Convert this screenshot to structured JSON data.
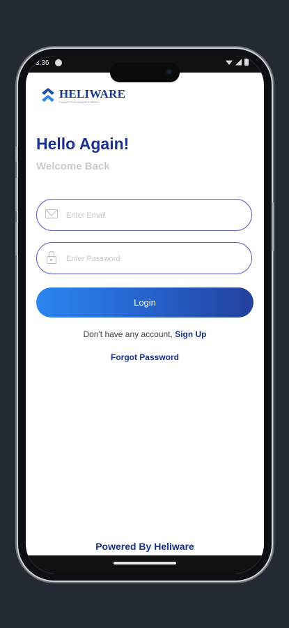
{
  "status_bar": {
    "time": "3:36"
  },
  "brand": {
    "name": "HELIWARE",
    "tagline": "A company for Developing Drone Solutions"
  },
  "login": {
    "title": "Hello Again!",
    "subtitle": "Welcome Back",
    "email_placeholder": "Enter Email",
    "password_placeholder": "Enter Password",
    "login_label": "Login",
    "no_account_text": "Don't have any account,",
    "signup_label": "Sign Up",
    "forgot_label": "Forgot Password"
  },
  "footer": {
    "powered_by": "Powered By Heliware"
  },
  "colors": {
    "primary": "#1b3190",
    "button_start": "#2b86f0",
    "button_end": "#24419e",
    "input_border": "#5a5fc9",
    "background": "#232a33"
  }
}
